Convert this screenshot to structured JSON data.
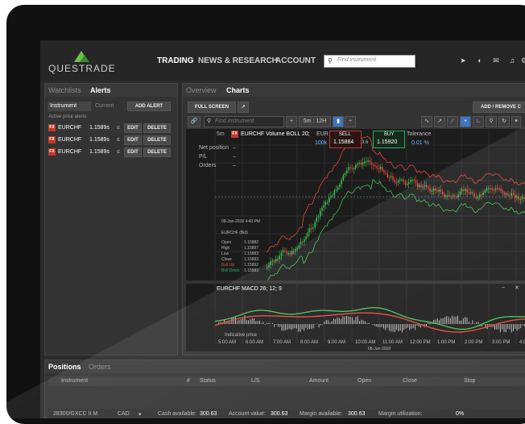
{
  "brand": {
    "logo_text": "QUESTRADE"
  },
  "nav": [
    {
      "label": "TRADING"
    },
    {
      "label": "NEWS & RESEARCH"
    },
    {
      "label": "ACCOUNT"
    }
  ],
  "search": {
    "placeholder": "Find instrument"
  },
  "top_icons": [
    "help-icon",
    "theme-toggle-icon",
    "mail-icon",
    "bell-icon",
    "settings-icon"
  ],
  "left_panel": {
    "tabs": [
      {
        "label": "Watchlists"
      },
      {
        "label": "Alerts"
      }
    ],
    "subtabs": [
      {
        "label": "Instrument"
      },
      {
        "label": "Current"
      }
    ],
    "add_alert": "ADD ALERT",
    "section_label": "Active price alerts",
    "alerts": [
      {
        "badge": "FX",
        "symbol": "EURCHF",
        "price": "1.1589s",
        "op": "≤",
        "edit": "EDIT",
        "delete": "DELETE"
      },
      {
        "badge": "FX",
        "symbol": "EURCHF",
        "price": "1.1589s",
        "op": "≤",
        "edit": "EDIT",
        "delete": "DELETE"
      },
      {
        "badge": "FX",
        "symbol": "EURCHF",
        "price": "1.1589s",
        "op": "≤",
        "edit": "EDIT",
        "delete": "DELETE"
      }
    ]
  },
  "chart_panel": {
    "tabs": [
      {
        "label": "Overview"
      },
      {
        "label": "Charts"
      }
    ],
    "full_screen": "FULL SCREEN",
    "add_remove": "ADD / REMOVE C",
    "find_placeholder": "Find instrument",
    "interval": "5m : 12H",
    "header": {
      "tf": "5m",
      "badge": "FX",
      "title": "EURCHF  Volume  BOLL 20;",
      "eur": "EUR",
      "pct": "100k"
    },
    "sell": {
      "label": "SELL",
      "price": "1.15884"
    },
    "buy": {
      "label": "BUY",
      "price": "1.15920"
    },
    "spread": "3.6",
    "tolerance": {
      "label": "Tolerance",
      "value": "0.01 %"
    },
    "position": [
      {
        "label": "Net position",
        "value": "–"
      },
      {
        "label": "P/L",
        "value": "–"
      },
      {
        "label": "Orders",
        "value": "–"
      }
    ],
    "tooltip": {
      "date": "08-Jun-2018 4:40 PM",
      "instrument": "EURCHF (Bid)",
      "rows": [
        {
          "label": "Open",
          "value": "1.15882"
        },
        {
          "label": "High",
          "value": "1.15897"
        },
        {
          "label": "Low",
          "value": "1.15883"
        },
        {
          "label": "Close",
          "value": "1.15893"
        },
        {
          "label": "Boll Up",
          "value": "1.15892"
        },
        {
          "label": "Boll Down",
          "value": "1.15883"
        }
      ]
    },
    "macd_title": "EURCHF  MACD 26; 12; 9",
    "indicative": "Indicative price",
    "x_ticks": [
      "5:00 AM",
      "6:00 AM",
      "7:00 AM",
      "8:00 AM",
      "9:00 AM",
      "10:00 AM",
      "11:00 AM",
      "12:00 PM",
      "1:00 PM",
      "2:00 PM",
      "3:00 PM",
      "4:00 PM"
    ],
    "date_label": "08-Jun-2018"
  },
  "bottom": {
    "tabs": [
      {
        "label": "Positions"
      },
      {
        "label": "Orders"
      }
    ],
    "columns": [
      "Instrument",
      "#",
      "Status",
      "L/S",
      "Amount",
      "Open",
      "Close",
      "Stop"
    ],
    "footer": {
      "account": "28300/GXCC II M",
      "currency": "CAD",
      "cash_label": "Cash available:",
      "cash": "300.63",
      "acct_label": "Account value:",
      "acct": "300.63",
      "margin_label": "Margin available:",
      "margin": "300.63",
      "util_label": "Margin utilization:",
      "util": "0%"
    }
  }
}
